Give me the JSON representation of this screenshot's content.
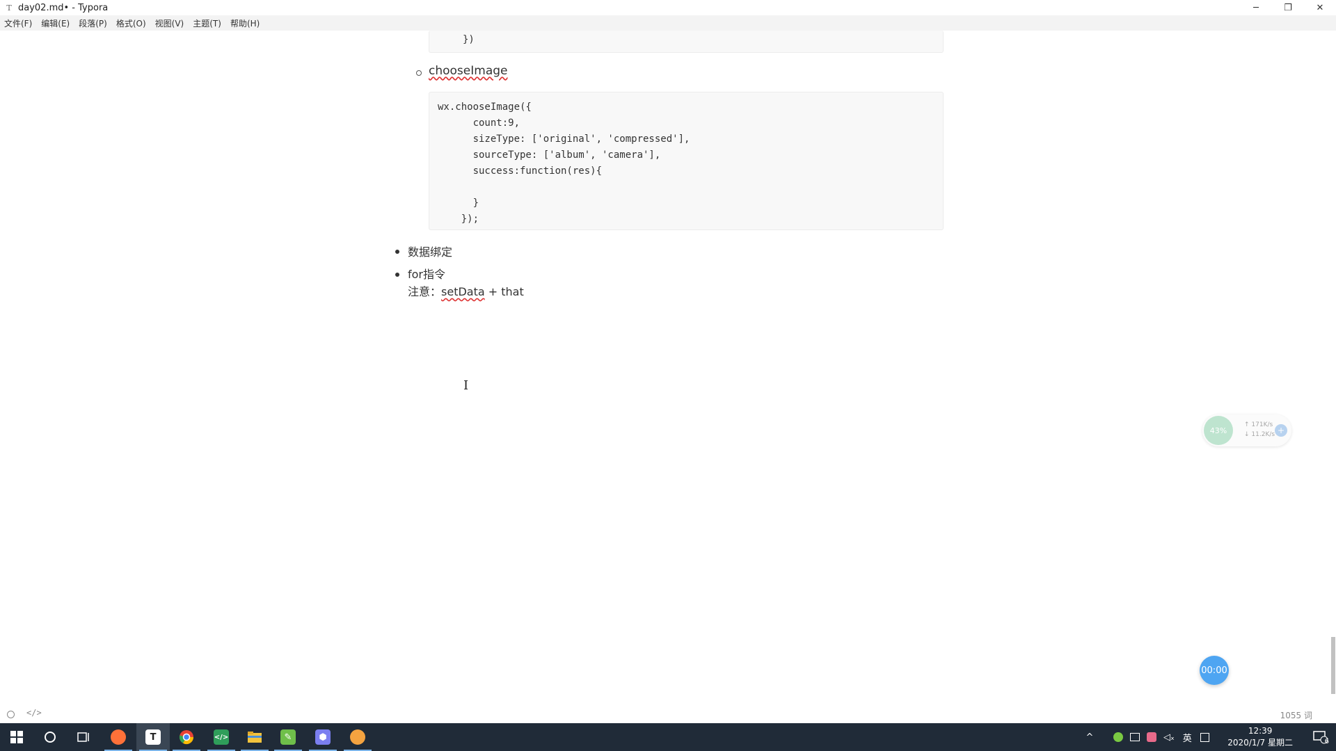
{
  "window": {
    "title": "day02.md• - Typora",
    "app_icon_glyph": "T",
    "controls": {
      "minimize": "─",
      "restore": "❐",
      "close": "✕"
    }
  },
  "menu": {
    "file": "文件(F)",
    "edit": "编辑(E)",
    "paragraph": "段落(P)",
    "format": "格式(O)",
    "view": "视图(V)",
    "theme": "主题(T)",
    "help": "帮助(H)"
  },
  "document": {
    "code_top": "})",
    "sub_item": "chooseImage",
    "code_main": "wx.chooseImage({\n      count:9,\n      sizeType: ['original', 'compressed'],\n      sourceType: ['album', 'camera'],\n      success:function(res){\n\n      }\n    });",
    "items": [
      "数据绑定",
      "for指令"
    ],
    "note_prefix": "注意：",
    "note_code": "setData",
    "note_suffix": " + that"
  },
  "widgets": {
    "net_percent": "43%",
    "upload_speed": "↑ 171K/s",
    "download_speed": "↓ 11.2K/s",
    "plus": "+",
    "timer": "00:00"
  },
  "status": {
    "source_toggle": "</>",
    "word_count": "1055 词"
  },
  "taskbar": {
    "start_icon": "start-icon",
    "apps": [
      {
        "name": "firefox-icon",
        "glyph": "◉",
        "color": "#ff7139"
      },
      {
        "name": "typora-icon",
        "glyph": "T",
        "color": "#ffffff"
      },
      {
        "name": "chrome-icon",
        "glyph": "◉",
        "color": "#e94235"
      },
      {
        "name": "code-editor-icon",
        "glyph": "</>",
        "color": "#2f9e5a"
      },
      {
        "name": "file-explorer-icon",
        "glyph": "▬",
        "color": "#f3c33d"
      },
      {
        "name": "notepad-icon",
        "glyph": "✎",
        "color": "#6fbf4a"
      },
      {
        "name": "app-hex-icon",
        "glyph": "⬢",
        "color": "#7b7ff0"
      },
      {
        "name": "app-orange-icon",
        "glyph": "●",
        "color": "#f4a340"
      }
    ],
    "tray": {
      "up_arrow": "^",
      "ime": "英",
      "time": "12:39",
      "date": "2020/1/7 星期二",
      "notifications": "6"
    }
  }
}
